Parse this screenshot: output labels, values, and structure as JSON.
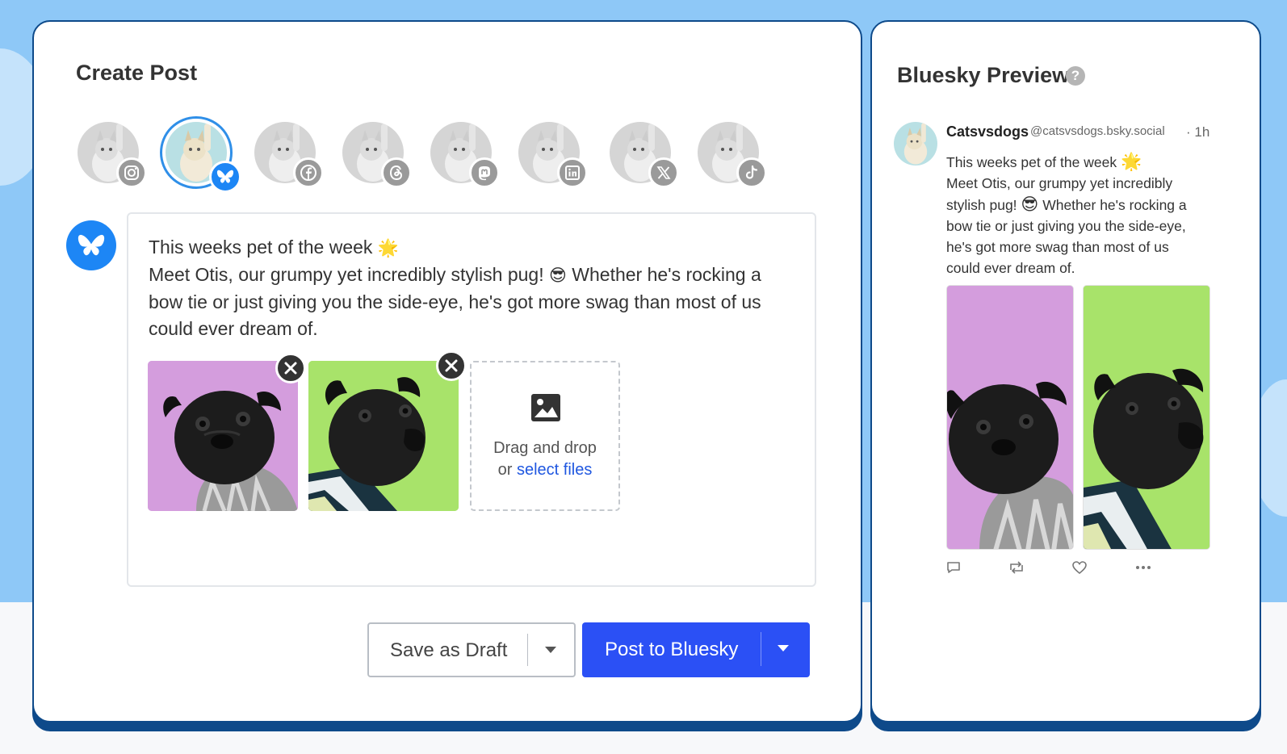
{
  "create_post": {
    "title": "Create Post",
    "accounts": [
      {
        "network": "Instagram",
        "icon": "instagram-icon",
        "selected": false
      },
      {
        "network": "Bluesky",
        "icon": "bluesky-icon",
        "selected": true
      },
      {
        "network": "Facebook",
        "icon": "facebook-icon",
        "selected": false
      },
      {
        "network": "Threads",
        "icon": "threads-icon",
        "selected": false
      },
      {
        "network": "Mastodon",
        "icon": "mastodon-icon",
        "selected": false
      },
      {
        "network": "LinkedIn",
        "icon": "linkedin-icon",
        "selected": false
      },
      {
        "network": "X",
        "icon": "x-icon",
        "selected": false
      },
      {
        "network": "TikTok",
        "icon": "tiktok-icon",
        "selected": false
      }
    ],
    "editor": {
      "lines": [
        "This weeks pet of the week",
        "Meet Otis, our grumpy yet incredibly stylish pug!",
        "Whether he's rocking a",
        "bow tie or just giving you the side-eye, he's got more swag than most of us",
        "could ever dream of."
      ],
      "emoji_sparkle": "🌟",
      "emoji_sunglasses": "😎",
      "attachments": [
        {
          "background": "#d49ddd",
          "icon": "pug-photo"
        },
        {
          "background": "#a8e36a",
          "icon": "pug-photo"
        }
      ],
      "dropzone": {
        "text": "Drag and drop",
        "or": "or",
        "link": "select files"
      }
    },
    "buttons": {
      "save_draft": "Save as Draft",
      "post": "Post to Bluesky"
    }
  },
  "preview": {
    "title": "Bluesky Preview",
    "help": "?",
    "author_name": "Catsvsdogs",
    "author_handle": "@catsvsdogs.bsky.social",
    "time": "· 1h",
    "lines": [
      "This weeks pet of the week",
      "Meet Otis, our grumpy yet incredibly",
      "stylish pug!",
      "Whether he's rocking a",
      "bow tie or just giving you the side-eye,",
      "he's got more swag than most of us",
      "could ever dream of."
    ],
    "actions": [
      "reply-icon",
      "repost-icon",
      "like-icon",
      "more-icon"
    ]
  },
  "colors": {
    "background_top": "#8ec8f7",
    "card_border": "#0e4a8a",
    "bluesky_blue": "#1d86f5",
    "post_button": "#2b50f5",
    "link": "#1f57e0"
  }
}
